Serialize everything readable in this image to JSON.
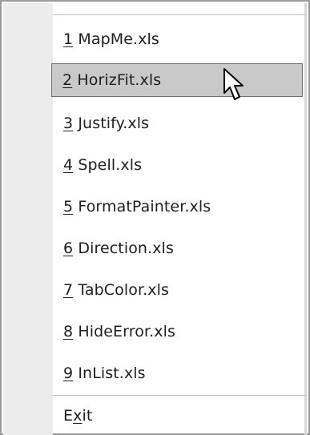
{
  "menu": {
    "recent_files": [
      {
        "mnemonic": "1",
        "name": "MapMe.xls",
        "selected": false
      },
      {
        "mnemonic": "2",
        "name": "HorizFit.xls",
        "selected": true
      },
      {
        "mnemonic": "3",
        "name": "Justify.xls",
        "selected": false
      },
      {
        "mnemonic": "4",
        "name": "Spell.xls",
        "selected": false
      },
      {
        "mnemonic": "5",
        "name": "FormatPainter.xls",
        "selected": false
      },
      {
        "mnemonic": "6",
        "name": "Direction.xls",
        "selected": false
      },
      {
        "mnemonic": "7",
        "name": "TabColor.xls",
        "selected": false
      },
      {
        "mnemonic": "8",
        "name": "HideError.xls",
        "selected": false
      },
      {
        "mnemonic": "9",
        "name": "InList.xls",
        "selected": false
      }
    ],
    "exit": {
      "before": "E",
      "mnemonic": "x",
      "after": "it"
    }
  },
  "cursor": {
    "icon": "arrow-pointer-icon"
  },
  "colors": {
    "selection_fill": "#c9c9c9",
    "selection_border": "#6f6f6f",
    "gutter": "#ececec"
  }
}
